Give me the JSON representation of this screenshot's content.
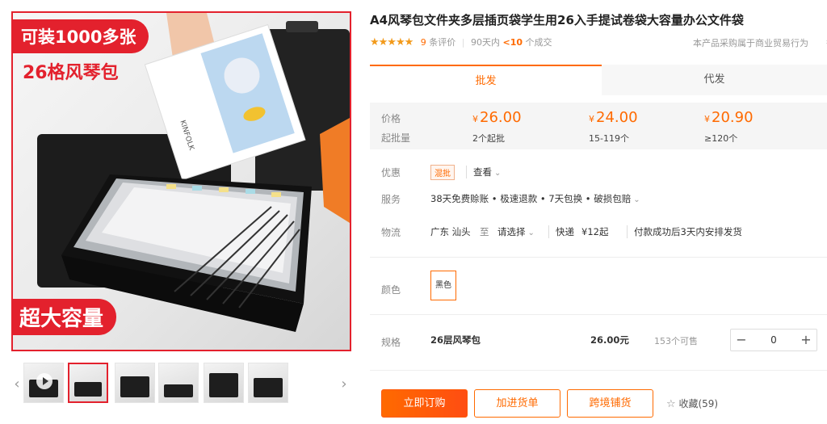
{
  "gallery": {
    "badge_top": "可装1000多张",
    "sub_title": "26格风琴包",
    "badge_bottom": "超大容量",
    "thumb_prev": "‹",
    "thumb_next": "›",
    "photo_text": "KINFOLK"
  },
  "product": {
    "title": "A4风琴包文件夹多层插页袋学生用26入手提试卷袋大容量办公文件袋",
    "rating_stars": "★★★★★",
    "reviews_count": "9",
    "reviews_suffix": "条评价",
    "deals_prefix": "90天内",
    "deals_count": "<10",
    "deals_suffix": "个成交",
    "trade_note": "本产品采购属于商业贸易行为",
    "trade_note_cut": "举"
  },
  "tabs": [
    {
      "label": "批发"
    },
    {
      "label": "代发"
    }
  ],
  "pricing": {
    "price_label": "价格",
    "qty_label": "起批量",
    "currency": "¥",
    "tiers": [
      {
        "price": "26.00",
        "qty": "2个起批"
      },
      {
        "price": "24.00",
        "qty": "15-119个"
      },
      {
        "price": "20.90",
        "qty": "≥120个"
      }
    ]
  },
  "promo": {
    "label": "优惠",
    "tag": "混批",
    "view": "查看"
  },
  "service": {
    "label": "服务",
    "text": "38天免费赊账 • 极速退款 • 7天包换 • 破损包赔"
  },
  "logistics": {
    "label": "物流",
    "origin": "广东 汕头",
    "to": "至",
    "select": "请选择",
    "express": "快递",
    "fee": "¥12起",
    "ship_note": "付款成功后3天内安排发货"
  },
  "color": {
    "label": "颜色",
    "option": "黑色"
  },
  "spec": {
    "label": "规格",
    "name": "26层风琴包",
    "price": "26.00元",
    "stock": "153个可售",
    "quantity": "0",
    "minus": "−",
    "plus": "+"
  },
  "actions": {
    "buy": "立即订购",
    "cart": "加进货单",
    "cross_border": "跨境铺货",
    "favorite": "收藏(59)"
  }
}
